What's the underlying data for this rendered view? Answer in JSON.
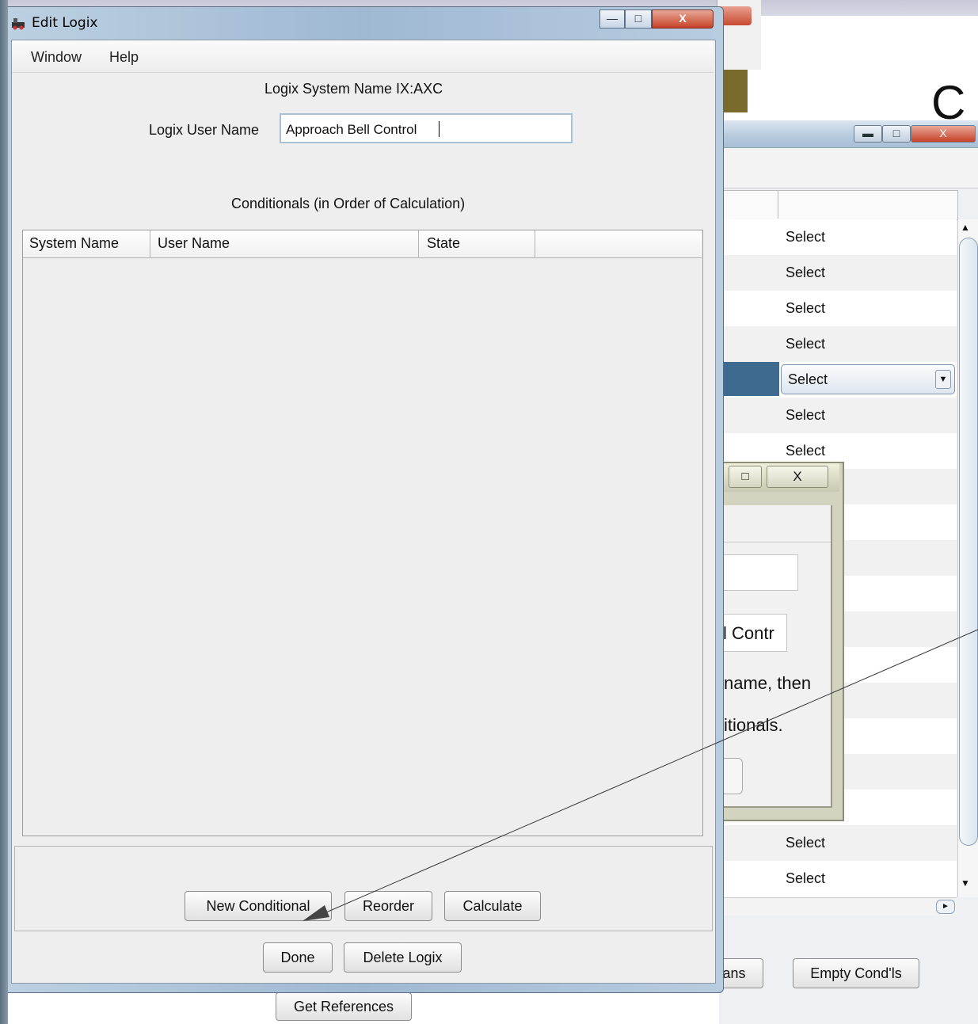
{
  "edit_logix": {
    "title": "Edit Logix",
    "menu": {
      "window": "Window",
      "help": "Help"
    },
    "system_name_label": "Logix System Name  IX:AXC",
    "user_name_label": "Logix User Name",
    "user_name_value": "Approach Bell Control",
    "conditionals_label": "Conditionals (in Order of Calculation)",
    "table_headers": [
      "System Name",
      "User Name",
      "State",
      ""
    ],
    "buttons": {
      "new_conditional": "New Conditional",
      "reorder": "Reorder",
      "calculate": "Calculate",
      "done": "Done",
      "delete_logix": "Delete Logix"
    },
    "window_buttons": {
      "minimize": "—",
      "maximize": "□",
      "close": "X"
    }
  },
  "logix_table": {
    "select_label": "Select",
    "rows_select": [
      "Select",
      "Select",
      "Select",
      "Select",
      "Select",
      "Select",
      "Select"
    ],
    "rows_select_bottom": [
      "Select",
      "Select"
    ],
    "buttons": {
      "plans_partial": "ans",
      "empty_conds": "Empty Cond'ls",
      "get_references": "Get References"
    }
  },
  "dialog_partial": {
    "field_value": "l Contr",
    "text_line1": "name, then",
    "text_line2": "itionals."
  },
  "slide_title_partial": "C"
}
